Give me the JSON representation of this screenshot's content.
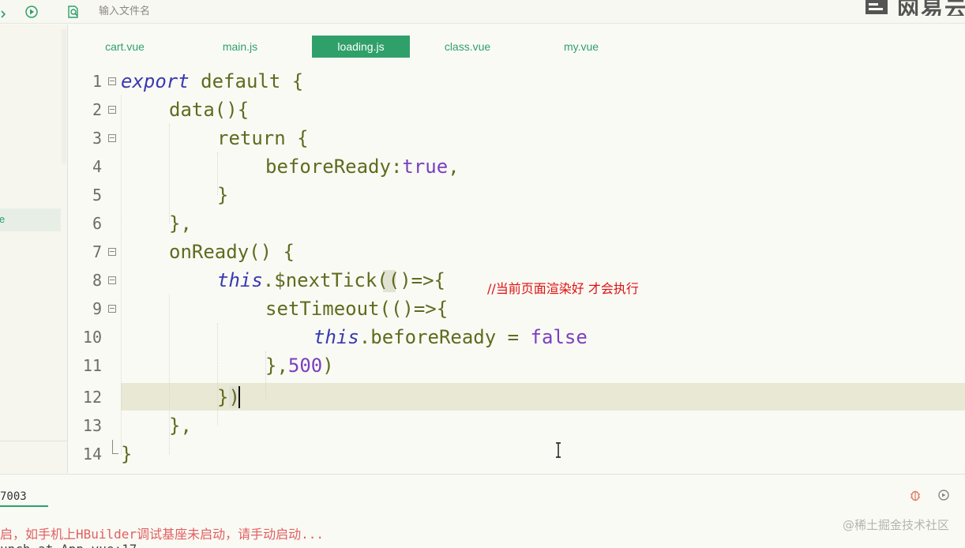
{
  "toolbar": {
    "search_placeholder": "输入文件名",
    "brand_text": "网易云"
  },
  "sidebar": {
    "selected_item_label": "e"
  },
  "tabs": [
    {
      "label": "cart.vue",
      "active": false
    },
    {
      "label": "main.js",
      "active": false
    },
    {
      "label": "loading.js",
      "active": true
    },
    {
      "label": "class.vue",
      "active": false
    },
    {
      "label": "my.vue",
      "active": false
    }
  ],
  "editor": {
    "line_numbers": [
      "1",
      "2",
      "3",
      "4",
      "5",
      "6",
      "7",
      "8",
      "9",
      "10",
      "11",
      "12",
      "13",
      "14"
    ],
    "current_line": 12,
    "code": {
      "l1_kw": "export",
      "l1_rest": " default {",
      "l2": "data(){",
      "l3": "return {",
      "l4_key": "beforeReady:",
      "l4_val": "true",
      "l4_end": ",",
      "l5": "}",
      "l6": "},",
      "l7": "onReady() {",
      "l8_this": "this",
      "l8_rest1": ".$nextTick",
      "l8_paren": "(",
      "l8_rest2": "()=>{",
      "l9": "setTimeout(()=>{",
      "l10_this": "this",
      "l10_mid": ".beforeReady = ",
      "l10_val": "false",
      "l11_a": "},",
      "l11_num": "500",
      "l11_b": ")",
      "l12_a": "}",
      "l12_b": ")",
      "l13": "},",
      "l14": "}"
    },
    "annotation": "//当前页面渲染好 才会执行"
  },
  "console": {
    "tab_label": "7003",
    "error_line": "启，如手机上HBuilder调试基座未启动，请手动启动...",
    "log_line": "unch at App.vue:17",
    "watermark": "@稀土掘金技术社区"
  },
  "colors": {
    "accent": "#2fa06a",
    "code_default": "#5f6b1e",
    "keyword": "#3a3ab0",
    "literal": "#7a3fbf",
    "annotation": "#dd1111",
    "current_line_bg": "#e9e8d4"
  },
  "icons": [
    "play-circle-icon",
    "file-search-icon",
    "debug-bug-icon",
    "refresh-icon",
    "text-cursor-icon"
  ]
}
